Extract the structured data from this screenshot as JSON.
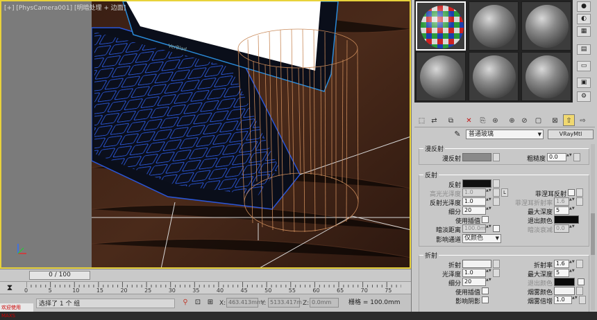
{
  "viewport": {
    "label": "[+] [PhysCamera001] [明暗处理 + 边面]"
  },
  "timeline": {
    "frame": "0 / 100",
    "ticks": [
      "0",
      "5",
      "10",
      "15",
      "20",
      "25",
      "30",
      "35",
      "40",
      "45",
      "50",
      "55",
      "60",
      "65",
      "70",
      "75"
    ]
  },
  "status": {
    "bottom_left": "欢迎使用 MAXS",
    "message": "选择了 1 个 组",
    "x_label": "X:",
    "x_value": "463.413mm",
    "y_label": "Y:",
    "y_value": "5133.417m",
    "z_label": "Z:",
    "z_value": "0.0mm",
    "grid": "栅格 = 100.0mm"
  },
  "material": {
    "name": "普通玻璃",
    "type": "VRayMtl"
  },
  "diffuse": {
    "title": "漫反射",
    "diffuse_label": "漫反射",
    "diffuse_color": "#8a8a8a",
    "roughness_label": "粗糙度",
    "roughness_value": "0.0"
  },
  "reflection": {
    "title": "反射",
    "reflect_label": "反射",
    "reflect_color": "#111111",
    "hilight_label": "高光光泽度",
    "hilight_value": "1.0",
    "lock": "L",
    "fresnel_label": "菲涅耳反射",
    "gloss_label": "反射光泽度",
    "gloss_value": "1.0",
    "fresnel_ior_label": "菲涅耳折射率",
    "fresnel_ior_value": "1.6",
    "subdivs_label": "细分",
    "subdivs_value": "20",
    "maxdepth_label": "最大深度",
    "maxdepth_value": "5",
    "interp_label": "使用插值",
    "exitcolor_label": "退出颜色",
    "exit_color": "#0a0a0a",
    "dimdist_label": "暗淡距离",
    "dimdist_value": "100.0m",
    "dimfalloff_label": "暗淡衰减",
    "dimfalloff_value": "0.0",
    "affect_label": "影响通道",
    "affect_value": "仅颜色"
  },
  "refraction": {
    "title": "折射",
    "refract_label": "折射",
    "refract_color": "#f2f2f2",
    "ior_label": "折射率",
    "ior_value": "1.6",
    "gloss_label": "光泽度",
    "gloss_value": "1.0",
    "maxdepth_label": "最大深度",
    "maxdepth_value": "5",
    "subdivs_label": "细分",
    "subdivs_value": "20",
    "exitcolor_label": "退出颜色",
    "exit_color": "#0a0a0a",
    "interp_label": "使用插值",
    "fogcolor_label": "烟雾颜色",
    "fog_color": "#f2f2f2",
    "shadow_label": "影响阴影",
    "fogmult_label": "烟雾倍增",
    "fogmult_value": "1.0"
  }
}
